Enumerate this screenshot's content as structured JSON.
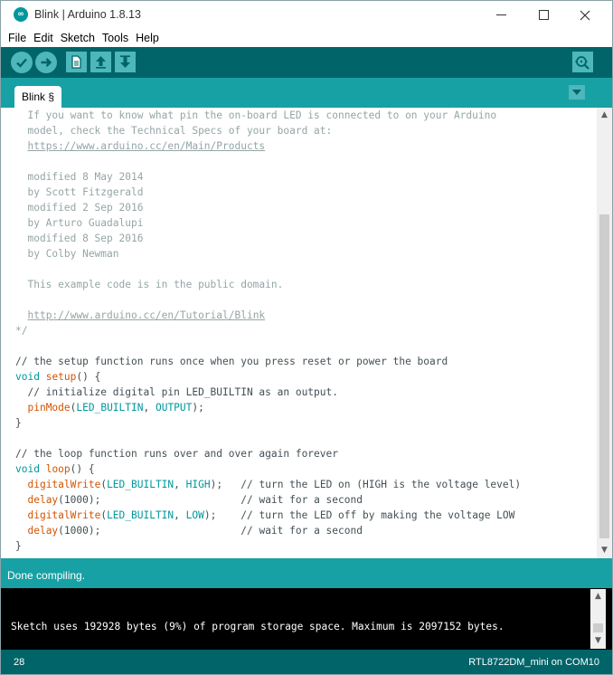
{
  "window": {
    "title": "Blink | Arduino 1.8.13",
    "app_icon": "arduino-logo-icon",
    "logo_glyph": "∞",
    "controls": [
      "minimize-icon",
      "maximize-icon",
      "close-icon"
    ]
  },
  "menu": [
    "File",
    "Edit",
    "Sketch",
    "Tools",
    "Help"
  ],
  "toolbar": {
    "buttons": [
      "verify-icon",
      "upload-icon",
      "new-icon",
      "open-icon",
      "save-icon",
      "serial-monitor-icon"
    ]
  },
  "tabs": [
    {
      "label": "Blink §",
      "active": true
    }
  ],
  "tab_menu_icon": "chevron-down-icon",
  "code_lines": [
    [
      {
        "t": "  If you want to know what pin the on-board LED is connected to on your Arduino",
        "c": "comment"
      }
    ],
    [
      {
        "t": "  model, check the Technical Specs of your board at:",
        "c": "comment"
      }
    ],
    [
      {
        "t": "  ",
        "c": "comment"
      },
      {
        "t": "https://www.arduino.cc/en/Main/Products",
        "c": "link"
      }
    ],
    [
      {
        "t": "",
        "c": "comment"
      }
    ],
    [
      {
        "t": "  modified 8 May 2014",
        "c": "comment"
      }
    ],
    [
      {
        "t": "  by Scott Fitzgerald",
        "c": "comment"
      }
    ],
    [
      {
        "t": "  modified 2 Sep 2016",
        "c": "comment"
      }
    ],
    [
      {
        "t": "  by Arturo Guadalupi",
        "c": "comment"
      }
    ],
    [
      {
        "t": "  modified 8 Sep 2016",
        "c": "comment"
      }
    ],
    [
      {
        "t": "  by Colby Newman",
        "c": "comment"
      }
    ],
    [
      {
        "t": "",
        "c": "comment"
      }
    ],
    [
      {
        "t": "  This example code is in the public domain.",
        "c": "comment"
      }
    ],
    [
      {
        "t": "",
        "c": "comment"
      }
    ],
    [
      {
        "t": "  ",
        "c": "comment"
      },
      {
        "t": "http://www.arduino.cc/en/Tutorial/Blink",
        "c": "link"
      }
    ],
    [
      {
        "t": "*/",
        "c": "comment"
      }
    ],
    [
      {
        "t": "",
        "c": "plain"
      }
    ],
    [
      {
        "t": "// the setup function runs once when you press reset or power the board",
        "c": "comment2"
      }
    ],
    [
      {
        "t": "void",
        "c": "kw"
      },
      {
        "t": " ",
        "c": "plain"
      },
      {
        "t": "setup",
        "c": "fn"
      },
      {
        "t": "() {",
        "c": "plain"
      }
    ],
    [
      {
        "t": "  // initialize digital pin LED_BUILTIN as an output.",
        "c": "comment2"
      }
    ],
    [
      {
        "t": "  ",
        "c": "plain"
      },
      {
        "t": "pinMode",
        "c": "fn"
      },
      {
        "t": "(",
        "c": "plain"
      },
      {
        "t": "LED_BUILTIN",
        "c": "const"
      },
      {
        "t": ", ",
        "c": "plain"
      },
      {
        "t": "OUTPUT",
        "c": "const"
      },
      {
        "t": ");",
        "c": "plain"
      }
    ],
    [
      {
        "t": "}",
        "c": "plain"
      }
    ],
    [
      {
        "t": "",
        "c": "plain"
      }
    ],
    [
      {
        "t": "// the loop function runs over and over again forever",
        "c": "comment2"
      }
    ],
    [
      {
        "t": "void",
        "c": "kw"
      },
      {
        "t": " ",
        "c": "plain"
      },
      {
        "t": "loop",
        "c": "fn"
      },
      {
        "t": "() {",
        "c": "plain"
      }
    ],
    [
      {
        "t": "  ",
        "c": "plain"
      },
      {
        "t": "digitalWrite",
        "c": "fn"
      },
      {
        "t": "(",
        "c": "plain"
      },
      {
        "t": "LED_BUILTIN",
        "c": "const"
      },
      {
        "t": ", ",
        "c": "plain"
      },
      {
        "t": "HIGH",
        "c": "const"
      },
      {
        "t": ");   ",
        "c": "plain"
      },
      {
        "t": "// turn the LED on (HIGH is the voltage level)",
        "c": "comment2"
      }
    ],
    [
      {
        "t": "  ",
        "c": "plain"
      },
      {
        "t": "delay",
        "c": "fn"
      },
      {
        "t": "(1000);                       ",
        "c": "plain"
      },
      {
        "t": "// wait for a second",
        "c": "comment2"
      }
    ],
    [
      {
        "t": "  ",
        "c": "plain"
      },
      {
        "t": "digitalWrite",
        "c": "fn"
      },
      {
        "t": "(",
        "c": "plain"
      },
      {
        "t": "LED_BUILTIN",
        "c": "const"
      },
      {
        "t": ", ",
        "c": "plain"
      },
      {
        "t": "LOW",
        "c": "const"
      },
      {
        "t": ");    ",
        "c": "plain"
      },
      {
        "t": "// turn the LED off by making the voltage LOW",
        "c": "comment2"
      }
    ],
    [
      {
        "t": "  ",
        "c": "plain"
      },
      {
        "t": "delay",
        "c": "fn"
      },
      {
        "t": "(1000);                       ",
        "c": "plain"
      },
      {
        "t": "// wait for a second",
        "c": "comment2"
      }
    ],
    [
      {
        "t": "}",
        "c": "plain"
      }
    ]
  ],
  "status": {
    "message": "Done compiling."
  },
  "console": {
    "output": "Sketch uses 192928 bytes (9%) of program storage space. Maximum is 2097152 bytes."
  },
  "footer": {
    "line_number": "28",
    "board": "RTL8722DM_mini on COM10"
  },
  "colors": {
    "toolbar": "#006468",
    "accent": "#17a1a5",
    "button": "#4db7bb",
    "keyword": "#00979c",
    "function": "#d35400",
    "comment": "#95a5a6"
  }
}
